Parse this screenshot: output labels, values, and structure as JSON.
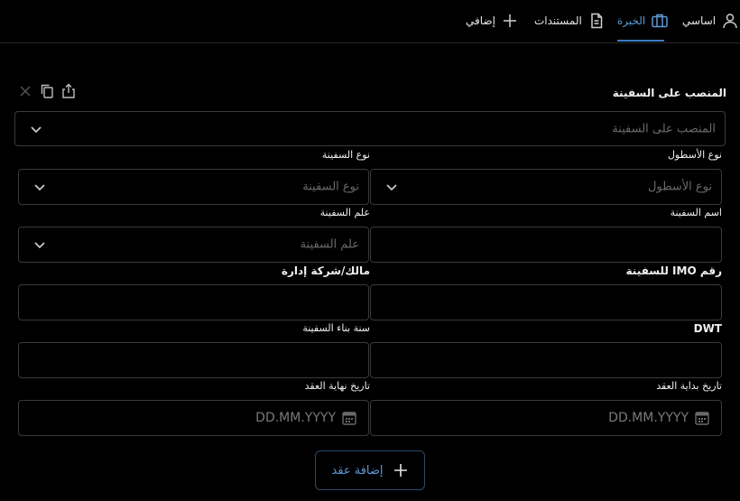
{
  "nav": {
    "tabs": [
      {
        "label": "اساسي",
        "icon": "user-icon"
      },
      {
        "label": "الخبرة",
        "icon": "briefcase-icon",
        "active": true
      },
      {
        "label": "المستندات",
        "icon": "document-icon"
      },
      {
        "label": "إضافي",
        "icon": "plus-icon"
      }
    ]
  },
  "form": {
    "position": {
      "label": "المنصب على السفينة",
      "placeholder": "المنصب على السفينة"
    },
    "fleet_type": {
      "label": "نوع الأسطول",
      "placeholder": "نوع الأسطول"
    },
    "vessel_type": {
      "label": "نوع السفينة",
      "placeholder": "نوع السفينة"
    },
    "vessel_name": {
      "label": "اسم السفينة"
    },
    "vessel_flag": {
      "label": "علم السفينة",
      "placeholder": "علم السفينة"
    },
    "imo": {
      "label": "رقم IMO للسفينة"
    },
    "owner": {
      "label": "مالك/شركة إدارة"
    },
    "dwt": {
      "label": "DWT"
    },
    "build_year": {
      "label": "سنة بناء السفينة"
    },
    "contract_start": {
      "label": "تاريخ بداية العقد",
      "placeholder": "DD.MM.YYYY"
    },
    "contract_end": {
      "label": "تاريخ نهاية العقد",
      "placeholder": "DD.MM.YYYY"
    }
  },
  "add_contract_button": "إضافة عقد",
  "colors": {
    "accent": "#5b9bd5",
    "border": "#3a3a3a",
    "background": "#000000"
  }
}
